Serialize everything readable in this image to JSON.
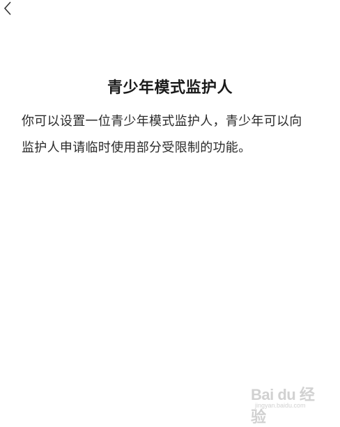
{
  "header": {
    "back_icon": "chevron-left-icon"
  },
  "main": {
    "title": "青少年模式监护人",
    "description": "你可以设置一位青少年模式监护人，青少年可以向监护人申请临时使用部分受限制的功能。"
  },
  "watermark": {
    "brand": "Bai du 经验",
    "url": "jingyan.baidu.com"
  }
}
